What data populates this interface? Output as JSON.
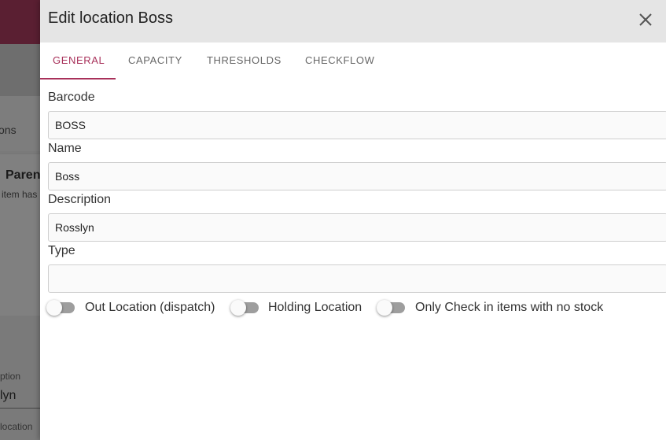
{
  "background": {
    "tab_fragment": "ons",
    "card_title_fragment": "Parent",
    "card_sub_fragment": "item has",
    "field_label_fragment": "ption",
    "field_value_fragment": "lyn",
    "field_label2_fragment": "location"
  },
  "dialog": {
    "title": "Edit location Boss",
    "close_icon": "close-icon",
    "tabs": [
      {
        "label": "GENERAL",
        "active": true
      },
      {
        "label": "CAPACITY",
        "active": false
      },
      {
        "label": "THRESHOLDS",
        "active": false
      },
      {
        "label": "CHECKFLOW",
        "active": false
      }
    ],
    "fields": {
      "barcode": {
        "label": "Barcode",
        "value": "BOSS"
      },
      "name": {
        "label": "Name",
        "value": "Boss"
      },
      "description": {
        "label": "Description",
        "value": "Rosslyn"
      },
      "type": {
        "label": "Type",
        "value": ""
      }
    },
    "toggles": [
      {
        "label": "Out Location (dispatch)",
        "on": false
      },
      {
        "label": "Holding Location",
        "on": false
      },
      {
        "label": "Only Check in items with no stock",
        "on": false
      }
    ]
  },
  "colors": {
    "accent": "#a8315a",
    "topbar": "#5a1f32",
    "header_bg": "#e5e5e5"
  }
}
